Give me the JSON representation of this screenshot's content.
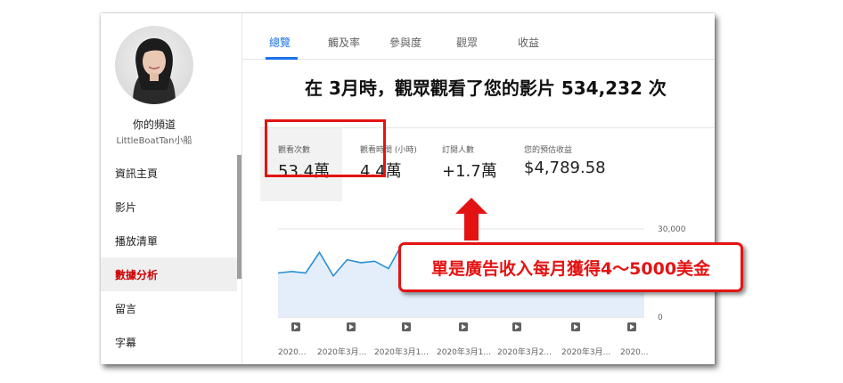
{
  "sidebar": {
    "channel_title": "你的頻道",
    "channel_handle": "LittleBoatTan小船",
    "items": [
      {
        "label": "資訊主頁",
        "active": false
      },
      {
        "label": "影片",
        "active": false
      },
      {
        "label": "播放清單",
        "active": false
      },
      {
        "label": "數據分析",
        "active": true
      },
      {
        "label": "留言",
        "active": false
      },
      {
        "label": "字幕",
        "active": false
      }
    ]
  },
  "tabs": [
    {
      "label": "總覽",
      "active": true
    },
    {
      "label": "觸及率",
      "active": false
    },
    {
      "label": "參與度",
      "active": false
    },
    {
      "label": "觀眾",
      "active": false
    },
    {
      "label": "收益",
      "active": false
    }
  ],
  "headline": "在 3月時，觀眾觀看了您的影片 534,232 次",
  "metrics": [
    {
      "label": "觀看次數",
      "value": "53.4萬",
      "selected": true
    },
    {
      "label": "觀看時間 (小時)",
      "value": "4.4萬",
      "selected": false
    },
    {
      "label": "訂閱人數",
      "value": "+1.7萬",
      "selected": false
    },
    {
      "label": "您的預估收益",
      "value": "$4,789.58",
      "selected": false
    }
  ],
  "chart_data": {
    "type": "area",
    "y_tick_labels": [
      "30,000",
      "0"
    ],
    "ylim": [
      0,
      30000
    ],
    "x_tick_labels": [
      "2020...",
      "2020年3月...",
      "2020年3月1...",
      "2020年3月1...",
      "2020年3月2...",
      "2020年3月...",
      "2020..."
    ],
    "visible_values": [
      15000,
      15500,
      15000,
      22000,
      14000,
      19500,
      18500,
      19000,
      16500,
      25000,
      16000
    ],
    "colors": {
      "line": "#2b8fd6",
      "fill": "#e3eefa"
    }
  },
  "annotation": {
    "callout_text": "單是廣告收入每月獲得4～5000美金",
    "color": "#e41313"
  }
}
